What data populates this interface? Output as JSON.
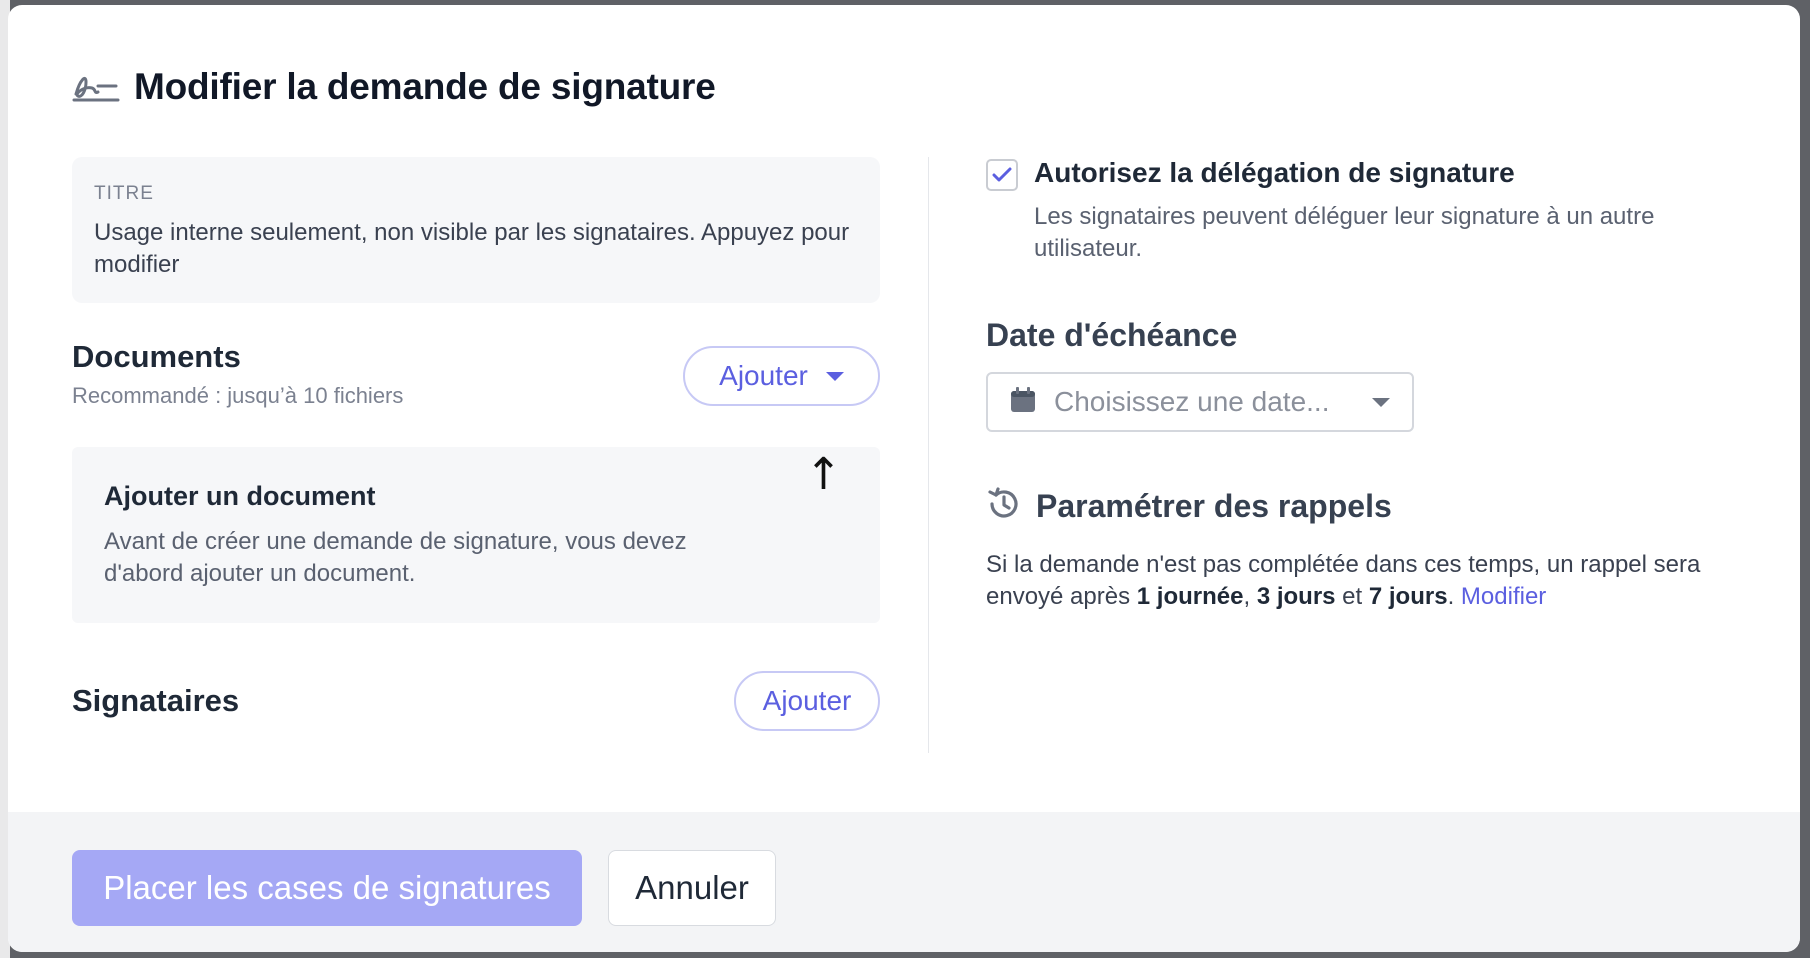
{
  "modal": {
    "title": "Modifier la demande de signature"
  },
  "titre": {
    "label": "TITRE",
    "help": "Usage interne seulement, non visible par les signataires. Appuyez pour modifier"
  },
  "documents": {
    "title": "Documents",
    "subtitle": "Recommandé : jusqu’à 10 fichiers",
    "add_button": "Ajouter",
    "empty_title": "Ajouter un document",
    "empty_text": "Avant de créer une demande de signature, vous devez d'abord ajouter un document.",
    "arrow": "↑"
  },
  "signataires": {
    "title": "Signataires",
    "add_button": "Ajouter"
  },
  "delegation": {
    "checked": true,
    "title": "Autorisez la délégation de signature",
    "description": "Les signataires peuvent déléguer leur signature à un autre utilisateur."
  },
  "due_date": {
    "title": "Date d'échéance",
    "placeholder": "Choisissez une date..."
  },
  "reminders": {
    "title": "Paramétrer des rappels",
    "text_before": "Si la demande n'est pas complétée dans ces temps, un rappel sera envoyé après ",
    "r1": "1 journée",
    "sep1": ", ",
    "r2": "3 jours",
    "sep2": " et ",
    "r3": "7 jours",
    "sep3": ". ",
    "modify_link": "Modifier"
  },
  "footer": {
    "primary_button": "Placer les cases de signatures",
    "cancel_button": "Annuler"
  },
  "colors": {
    "accent": "#5b5fe0",
    "primary_disabled": "#a5a8f5"
  }
}
